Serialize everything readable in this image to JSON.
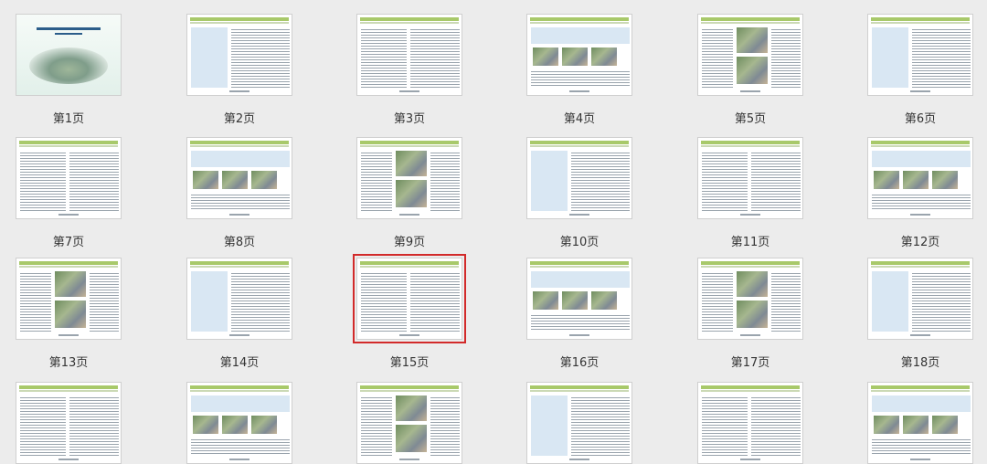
{
  "pages": [
    {
      "label": "第1页"
    },
    {
      "label": "第2页"
    },
    {
      "label": "第3页"
    },
    {
      "label": "第4页"
    },
    {
      "label": "第5页"
    },
    {
      "label": "第6页"
    },
    {
      "label": "第7页"
    },
    {
      "label": "第8页"
    },
    {
      "label": "第9页"
    },
    {
      "label": "第10页"
    },
    {
      "label": "第11页"
    },
    {
      "label": "第12页"
    },
    {
      "label": "第13页"
    },
    {
      "label": "第14页"
    },
    {
      "label": "第15页"
    },
    {
      "label": "第16页"
    },
    {
      "label": "第17页"
    },
    {
      "label": "第18页"
    },
    {
      "label": ""
    },
    {
      "label": ""
    },
    {
      "label": ""
    },
    {
      "label": ""
    },
    {
      "label": ""
    },
    {
      "label": ""
    }
  ],
  "selected_page": "第15页",
  "colors": {
    "background": "#ececec",
    "selection_border": "#d22a2a",
    "header_green": "#a8c96a",
    "accent_blue": "#d9e7f3"
  }
}
